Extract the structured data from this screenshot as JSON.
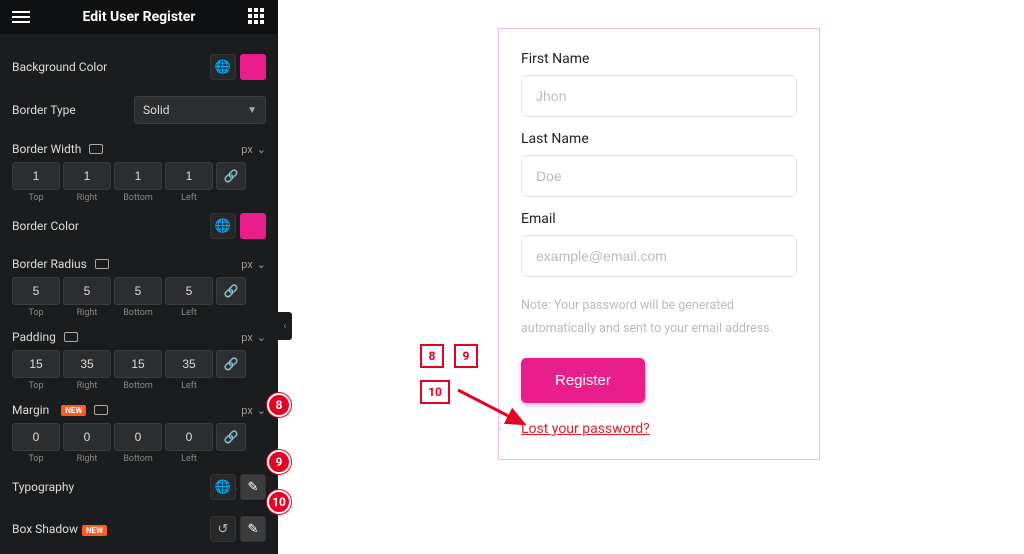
{
  "header": {
    "title": "Edit User Register"
  },
  "bgColor": {
    "label": "Background Color",
    "value": "#e91e8c"
  },
  "borderType": {
    "label": "Border Type",
    "value": "Solid"
  },
  "borderWidth": {
    "label": "Border Width",
    "unit": "px",
    "top": "1",
    "right": "1",
    "bottom": "1",
    "left": "1"
  },
  "borderColor": {
    "label": "Border Color",
    "value": "#e91e8c"
  },
  "borderRadius": {
    "label": "Border Radius",
    "unit": "px",
    "top": "5",
    "right": "5",
    "bottom": "5",
    "left": "5"
  },
  "padding": {
    "label": "Padding",
    "unit": "px",
    "top": "15",
    "right": "35",
    "bottom": "15",
    "left": "35"
  },
  "margin": {
    "label": "Margin",
    "badge": "NEW",
    "unit": "px",
    "top": "0",
    "right": "0",
    "bottom": "0",
    "left": "0"
  },
  "typography": {
    "label": "Typography"
  },
  "boxShadow": {
    "label": "Box Shadow",
    "badge": "NEW"
  },
  "sides": {
    "top": "Top",
    "right": "Right",
    "bottom": "Bottom",
    "left": "Left"
  },
  "form": {
    "firstName": {
      "label": "First Name",
      "placeholder": "Jhon"
    },
    "lastName": {
      "label": "Last Name",
      "placeholder": "Doe"
    },
    "email": {
      "label": "Email",
      "placeholder": "example@email.com"
    },
    "note": "Note: Your password will be generated automatically and sent to your email address.",
    "register": "Register",
    "lost": "Lost your password?"
  },
  "annotations": {
    "a8": "8",
    "a9": "9",
    "a10": "10"
  }
}
